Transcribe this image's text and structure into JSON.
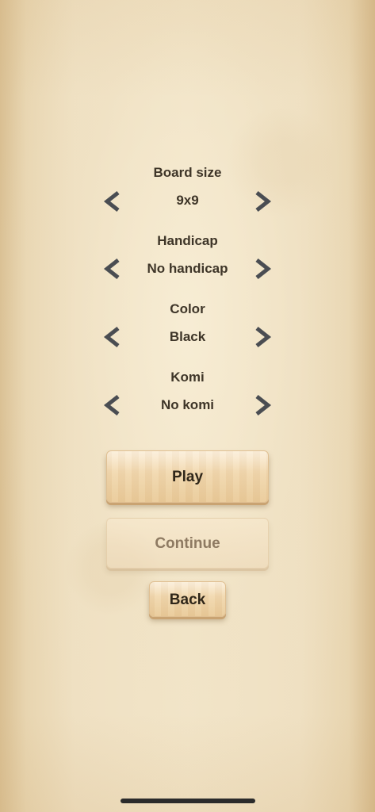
{
  "settings": {
    "board_size": {
      "label": "Board size",
      "value": "9x9"
    },
    "handicap": {
      "label": "Handicap",
      "value": "No handicap"
    },
    "color": {
      "label": "Color",
      "value": "Black"
    },
    "komi": {
      "label": "Komi",
      "value": "No komi"
    }
  },
  "buttons": {
    "play": "Play",
    "continue": "Continue",
    "back": "Back"
  },
  "icons": {
    "previous": "chevron-left-icon",
    "next": "chevron-right-icon"
  },
  "colors": {
    "text": "#3e3528",
    "arrow": "#4a4d52",
    "disabled_text": "#8e7a62"
  }
}
